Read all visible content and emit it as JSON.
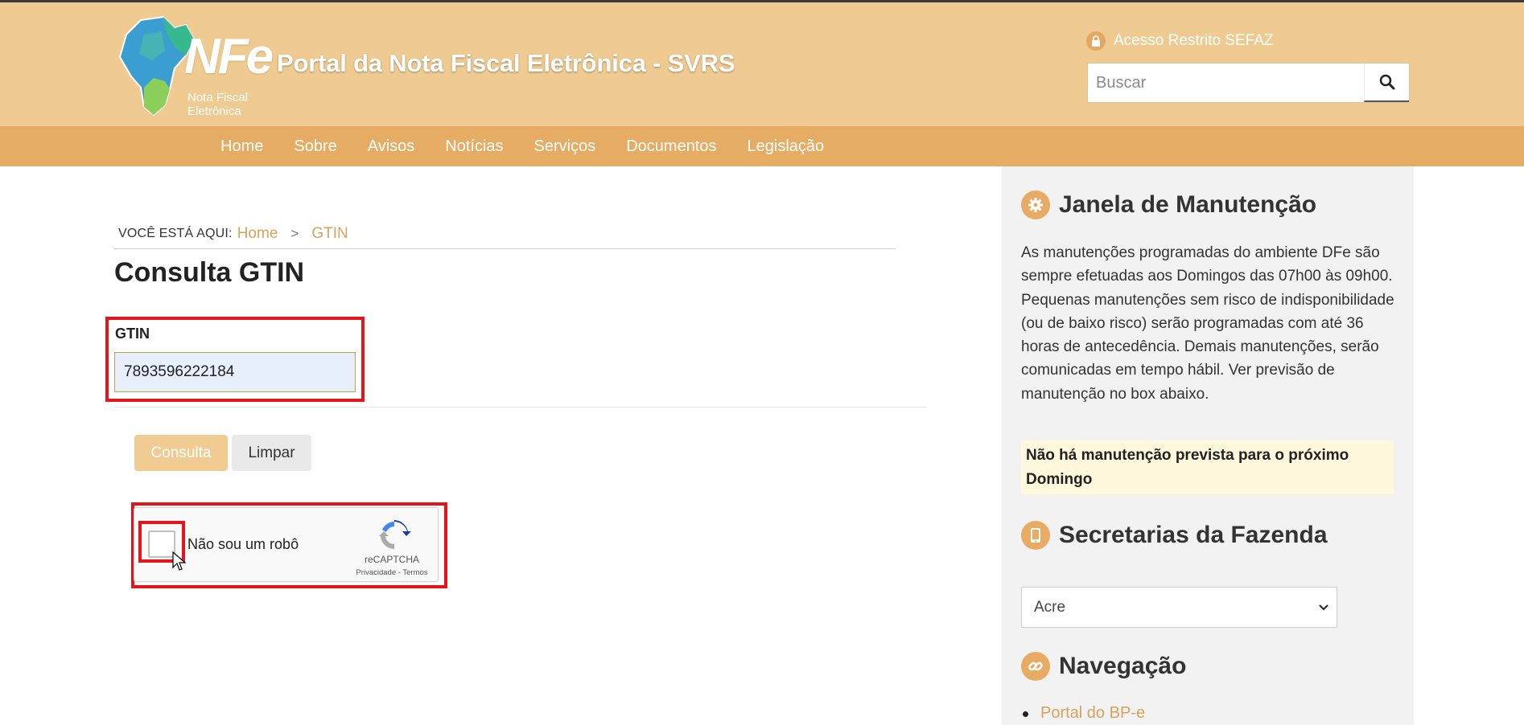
{
  "header": {
    "logo_text": "NFe",
    "logo_subtitle_line1": "Nota Fiscal",
    "logo_subtitle_line2": "Eletrônica",
    "site_title": "Portal da Nota Fiscal Eletrônica - SVRS",
    "restricted_label": "Acesso Restrito SEFAZ",
    "search_placeholder": "Buscar"
  },
  "nav": {
    "items": [
      {
        "label": "Home"
      },
      {
        "label": "Sobre"
      },
      {
        "label": "Avisos"
      },
      {
        "label": "Notícias"
      },
      {
        "label": "Serviços"
      },
      {
        "label": "Documentos"
      },
      {
        "label": "Legislação"
      }
    ]
  },
  "breadcrumb": {
    "you_are_here": "Você está aqui:",
    "items": [
      {
        "label": "Home"
      },
      {
        "label": "GTIN"
      }
    ],
    "separator": ">"
  },
  "main": {
    "page_title": "Consulta GTIN",
    "gtin_label": "GTIN",
    "gtin_value": "7893596222184",
    "consulta_button": "Consulta",
    "limpar_button": "Limpar"
  },
  "recaptcha": {
    "label": "Não sou um robô",
    "brand": "reCAPTCHA",
    "links": "Privacidade - Termos",
    "checked": false
  },
  "sidebar": {
    "maintenance_title": "Janela de Manutenção",
    "maintenance_text": "As manutenções programadas do ambiente DFe são sempre efetuadas aos Domingos das 07h00 às 09h00. Pequenas manutenções sem risco de indisponibilidade (ou de baixo risco) serão programadas com até 36 horas de antecedência. Demais manutenções, serão comunicadas em tempo hábil. Ver previsão de manutenção no box abaixo.",
    "notice_line1": "Não há manutenção prevista para o próximo",
    "notice_line2": "Domingo",
    "secretarias_title": "Secretarias da Fazenda",
    "state_selected": "Acre",
    "navegacao_title": "Navegação",
    "nav_links": [
      {
        "label": "Portal do BP-e"
      }
    ]
  },
  "colors": {
    "header_bg": "#efcb91",
    "nav_bg": "#e7ac63",
    "accent": "#d9a25b",
    "highlight": "#e3141a"
  },
  "icons": {
    "restricted": "lock-icon",
    "search": "search-icon",
    "maintenance": "gear-icon",
    "secretarias": "tablet-icon",
    "navegacao": "link-icon",
    "select": "chevron-down-icon"
  }
}
